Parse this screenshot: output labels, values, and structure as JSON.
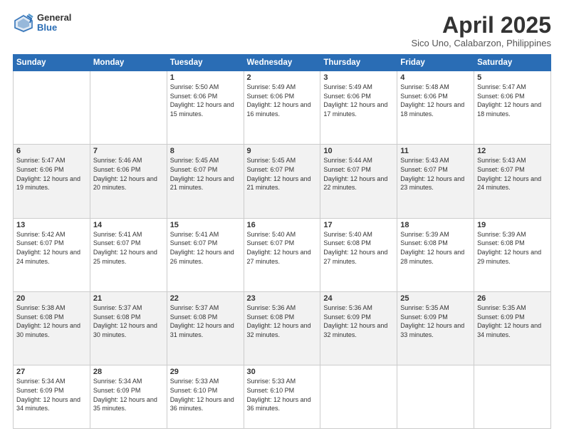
{
  "logo": {
    "general": "General",
    "blue": "Blue"
  },
  "header": {
    "month": "April 2025",
    "location": "Sico Uno, Calabarzon, Philippines"
  },
  "days_of_week": [
    "Sunday",
    "Monday",
    "Tuesday",
    "Wednesday",
    "Thursday",
    "Friday",
    "Saturday"
  ],
  "weeks": [
    [
      {
        "num": "",
        "info": ""
      },
      {
        "num": "",
        "info": ""
      },
      {
        "num": "1",
        "info": "Sunrise: 5:50 AM\nSunset: 6:06 PM\nDaylight: 12 hours and 15 minutes."
      },
      {
        "num": "2",
        "info": "Sunrise: 5:49 AM\nSunset: 6:06 PM\nDaylight: 12 hours and 16 minutes."
      },
      {
        "num": "3",
        "info": "Sunrise: 5:49 AM\nSunset: 6:06 PM\nDaylight: 12 hours and 17 minutes."
      },
      {
        "num": "4",
        "info": "Sunrise: 5:48 AM\nSunset: 6:06 PM\nDaylight: 12 hours and 18 minutes."
      },
      {
        "num": "5",
        "info": "Sunrise: 5:47 AM\nSunset: 6:06 PM\nDaylight: 12 hours and 18 minutes."
      }
    ],
    [
      {
        "num": "6",
        "info": "Sunrise: 5:47 AM\nSunset: 6:06 PM\nDaylight: 12 hours and 19 minutes."
      },
      {
        "num": "7",
        "info": "Sunrise: 5:46 AM\nSunset: 6:06 PM\nDaylight: 12 hours and 20 minutes."
      },
      {
        "num": "8",
        "info": "Sunrise: 5:45 AM\nSunset: 6:07 PM\nDaylight: 12 hours and 21 minutes."
      },
      {
        "num": "9",
        "info": "Sunrise: 5:45 AM\nSunset: 6:07 PM\nDaylight: 12 hours and 21 minutes."
      },
      {
        "num": "10",
        "info": "Sunrise: 5:44 AM\nSunset: 6:07 PM\nDaylight: 12 hours and 22 minutes."
      },
      {
        "num": "11",
        "info": "Sunrise: 5:43 AM\nSunset: 6:07 PM\nDaylight: 12 hours and 23 minutes."
      },
      {
        "num": "12",
        "info": "Sunrise: 5:43 AM\nSunset: 6:07 PM\nDaylight: 12 hours and 24 minutes."
      }
    ],
    [
      {
        "num": "13",
        "info": "Sunrise: 5:42 AM\nSunset: 6:07 PM\nDaylight: 12 hours and 24 minutes."
      },
      {
        "num": "14",
        "info": "Sunrise: 5:41 AM\nSunset: 6:07 PM\nDaylight: 12 hours and 25 minutes."
      },
      {
        "num": "15",
        "info": "Sunrise: 5:41 AM\nSunset: 6:07 PM\nDaylight: 12 hours and 26 minutes."
      },
      {
        "num": "16",
        "info": "Sunrise: 5:40 AM\nSunset: 6:07 PM\nDaylight: 12 hours and 27 minutes."
      },
      {
        "num": "17",
        "info": "Sunrise: 5:40 AM\nSunset: 6:08 PM\nDaylight: 12 hours and 27 minutes."
      },
      {
        "num": "18",
        "info": "Sunrise: 5:39 AM\nSunset: 6:08 PM\nDaylight: 12 hours and 28 minutes."
      },
      {
        "num": "19",
        "info": "Sunrise: 5:39 AM\nSunset: 6:08 PM\nDaylight: 12 hours and 29 minutes."
      }
    ],
    [
      {
        "num": "20",
        "info": "Sunrise: 5:38 AM\nSunset: 6:08 PM\nDaylight: 12 hours and 30 minutes."
      },
      {
        "num": "21",
        "info": "Sunrise: 5:37 AM\nSunset: 6:08 PM\nDaylight: 12 hours and 30 minutes."
      },
      {
        "num": "22",
        "info": "Sunrise: 5:37 AM\nSunset: 6:08 PM\nDaylight: 12 hours and 31 minutes."
      },
      {
        "num": "23",
        "info": "Sunrise: 5:36 AM\nSunset: 6:08 PM\nDaylight: 12 hours and 32 minutes."
      },
      {
        "num": "24",
        "info": "Sunrise: 5:36 AM\nSunset: 6:09 PM\nDaylight: 12 hours and 32 minutes."
      },
      {
        "num": "25",
        "info": "Sunrise: 5:35 AM\nSunset: 6:09 PM\nDaylight: 12 hours and 33 minutes."
      },
      {
        "num": "26",
        "info": "Sunrise: 5:35 AM\nSunset: 6:09 PM\nDaylight: 12 hours and 34 minutes."
      }
    ],
    [
      {
        "num": "27",
        "info": "Sunrise: 5:34 AM\nSunset: 6:09 PM\nDaylight: 12 hours and 34 minutes."
      },
      {
        "num": "28",
        "info": "Sunrise: 5:34 AM\nSunset: 6:09 PM\nDaylight: 12 hours and 35 minutes."
      },
      {
        "num": "29",
        "info": "Sunrise: 5:33 AM\nSunset: 6:10 PM\nDaylight: 12 hours and 36 minutes."
      },
      {
        "num": "30",
        "info": "Sunrise: 5:33 AM\nSunset: 6:10 PM\nDaylight: 12 hours and 36 minutes."
      },
      {
        "num": "",
        "info": ""
      },
      {
        "num": "",
        "info": ""
      },
      {
        "num": "",
        "info": ""
      }
    ]
  ]
}
